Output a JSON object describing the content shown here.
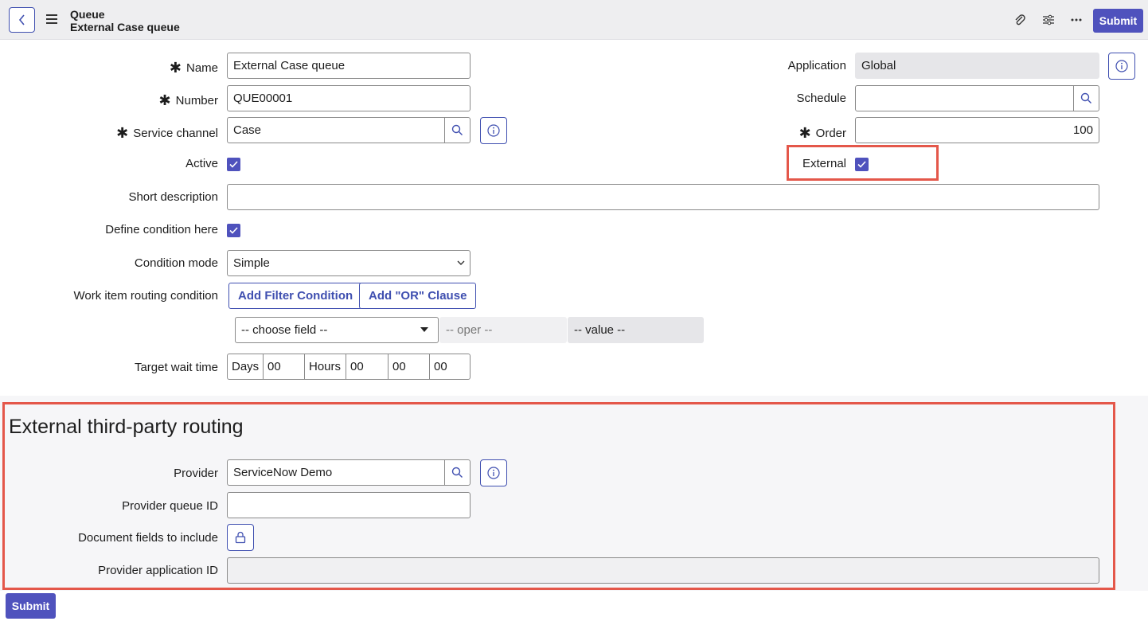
{
  "header": {
    "title": "Queue",
    "subtitle": "External Case queue",
    "submit_label": "Submit"
  },
  "form": {
    "name": {
      "label": "Name",
      "value": "External Case queue"
    },
    "number": {
      "label": "Number",
      "value": "QUE00001"
    },
    "service_channel": {
      "label": "Service channel",
      "value": "Case"
    },
    "active": {
      "label": "Active",
      "checked": true
    },
    "short_description": {
      "label": "Short description",
      "value": ""
    },
    "define_condition": {
      "label": "Define condition here",
      "checked": true
    },
    "condition_mode": {
      "label": "Condition mode",
      "value": "Simple"
    },
    "routing_condition": {
      "label": "Work item routing condition",
      "add_filter": "Add Filter Condition",
      "add_or": "Add \"OR\" Clause"
    },
    "filter_row": {
      "field": "-- choose field --",
      "oper": "-- oper --",
      "value": "-- value --"
    },
    "target_wait": {
      "label": "Target wait time",
      "days_label": "Days",
      "days": "00",
      "hours_label": "Hours",
      "hours": "00",
      "minutes": "00",
      "seconds": "00"
    },
    "application": {
      "label": "Application",
      "value": "Global"
    },
    "schedule": {
      "label": "Schedule",
      "value": ""
    },
    "order": {
      "label": "Order",
      "value": "100"
    },
    "external": {
      "label": "External",
      "checked": true
    }
  },
  "external_section": {
    "title": "External third-party routing",
    "provider": {
      "label": "Provider",
      "value": "ServiceNow Demo"
    },
    "provider_queue_id": {
      "label": "Provider queue ID",
      "value": ""
    },
    "document_fields": {
      "label": "Document fields to include"
    },
    "provider_app_id": {
      "label": "Provider application ID",
      "value": ""
    }
  },
  "footer": {
    "submit_label": "Submit"
  },
  "colors": {
    "accent": "#4f52bd",
    "highlight": "#e4574a"
  }
}
